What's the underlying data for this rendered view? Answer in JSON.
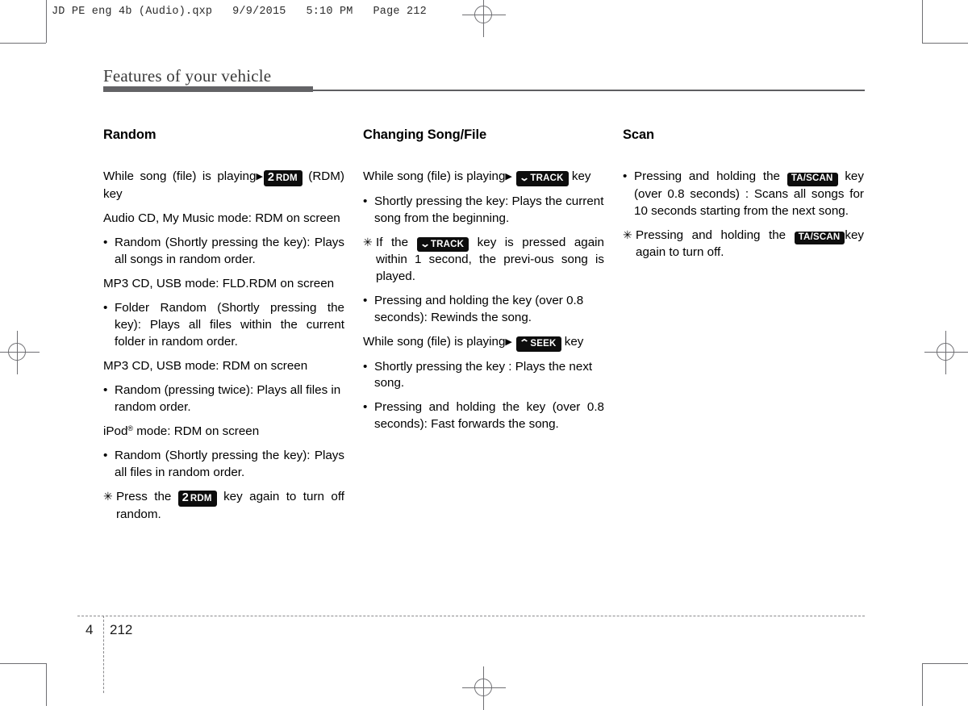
{
  "print_header": "JD PE eng 4b (Audio).qxp   9/9/2015   5:10 PM   Page 212",
  "running_head": "Features of your vehicle",
  "footer": {
    "chapter": "4",
    "page": "212"
  },
  "colors": {
    "rule": "#636366",
    "key_badge_bg": "#0d0d0d",
    "key_badge_text": "#ffffff",
    "crop_mark": "#6f6f73"
  },
  "keys": {
    "rdm": {
      "number": "2",
      "label": "RDM"
    },
    "track": {
      "chevron": "⌄",
      "label": "TRACK"
    },
    "seek": {
      "chevron": "⌃",
      "label": "SEEK"
    },
    "tascan": {
      "label": "TA/SCAN"
    }
  },
  "markers": {
    "bullet": "•",
    "note": "✳",
    "arrow": "▶"
  },
  "columns": [
    {
      "title": "Random",
      "blocks": [
        {
          "type": "para_key",
          "text_before": "While song (file) is playing",
          "key": "rdm",
          "text_after": "(RDM) key"
        },
        {
          "type": "para",
          "text": "Audio CD, My Music mode: RDM on screen"
        },
        {
          "type": "bullet",
          "text": "Random (Shortly pressing the key): Plays all songs in random order."
        },
        {
          "type": "para",
          "text": "MP3 CD, USB mode: FLD.RDM on screen"
        },
        {
          "type": "bullet",
          "text": "Folder Random (Shortly pressing the key): Plays all files within the current folder in random order."
        },
        {
          "type": "para",
          "text": "MP3 CD, USB mode: RDM on screen"
        },
        {
          "type": "bullet",
          "text": "Random (pressing twice): Plays all files in random order."
        },
        {
          "type": "para_ipod",
          "text_before": "iPod",
          "reg": "®",
          "text_after": " mode: RDM on screen"
        },
        {
          "type": "bullet",
          "text": "Random (Shortly pressing the key): Plays all files in random order."
        },
        {
          "type": "note_key",
          "text_before": "Press the",
          "key": "rdm",
          "text_after": "key again to turn off random."
        }
      ]
    },
    {
      "title": "Changing Song/File",
      "blocks": [
        {
          "type": "para_key",
          "text_before": "While song (file) is playing",
          "key": "track",
          "text_after": "key"
        },
        {
          "type": "bullet",
          "text": "Shortly pressing the key: Plays the current song from the beginning."
        },
        {
          "type": "note_key",
          "text_before": "If the",
          "key": "track",
          "text_after": "key is pressed again within 1 second, the previ-ous song is played."
        },
        {
          "type": "bullet",
          "text": "Pressing and holding the key (over 0.8 seconds): Rewinds the song."
        },
        {
          "type": "para_key",
          "text_before": "While song (file) is playing",
          "key": "seek",
          "text_after": "key"
        },
        {
          "type": "bullet",
          "text": "Shortly pressing the key : Plays the next song."
        },
        {
          "type": "bullet",
          "text": "Pressing and holding the key (over 0.8 seconds): Fast forwards the song."
        }
      ]
    },
    {
      "title": "Scan",
      "blocks": [
        {
          "type": "bullet_key",
          "text_before": "Pressing and holding the",
          "key": "tascan",
          "text_after": "key (over 0.8 seconds) : Scans all songs for 10 seconds starting from the next song."
        },
        {
          "type": "note_key",
          "text_before": "Pressing and holding the",
          "key": "tascan",
          "text_after": "key again to turn off."
        }
      ]
    }
  ]
}
